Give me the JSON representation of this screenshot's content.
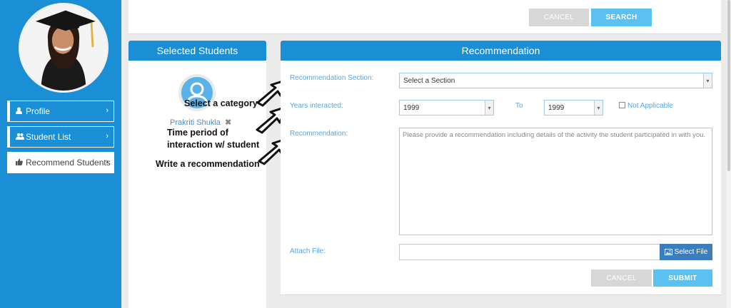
{
  "sidebar": {
    "nav": [
      {
        "label": "Profile",
        "icon": "user-icon"
      },
      {
        "label": "Student List",
        "icon": "users-icon"
      },
      {
        "label": "Recommend Students",
        "icon": "thumbs-up-icon"
      }
    ],
    "chevron": "›"
  },
  "search_bar": {
    "cancel_label": "CANCEL",
    "search_label": "SEARCH"
  },
  "selected_students": {
    "title": "Selected Students",
    "student_name": "Prakriti Shukla",
    "remove_glyph": "✖"
  },
  "annotations": {
    "category": "Select a category",
    "time_period_1": "Time period of",
    "time_period_2": "interaction w/ student",
    "write": "Write a recommendation"
  },
  "recommendation": {
    "title": "Recommendation",
    "section_label": "Recommendation Section:",
    "section_value": "Select a Section",
    "years_label": "Years interacted:",
    "year_from": "1999",
    "to_label": "To",
    "year_to": "1999",
    "not_applicable_label": "Not Applicable",
    "text_label": "Recommendation:",
    "text_placeholder": "Please provide a recommendation including details of the activity the student participated in with you.",
    "attach_label": "Attach File:",
    "select_file_label": "Select File",
    "cancel_label": "CANCEL",
    "submit_label": "SUBMIT"
  },
  "colors": {
    "brand_blue": "#1a8fd6",
    "button_blue": "#5bc1f2",
    "button_grey": "#d7d7d7"
  }
}
